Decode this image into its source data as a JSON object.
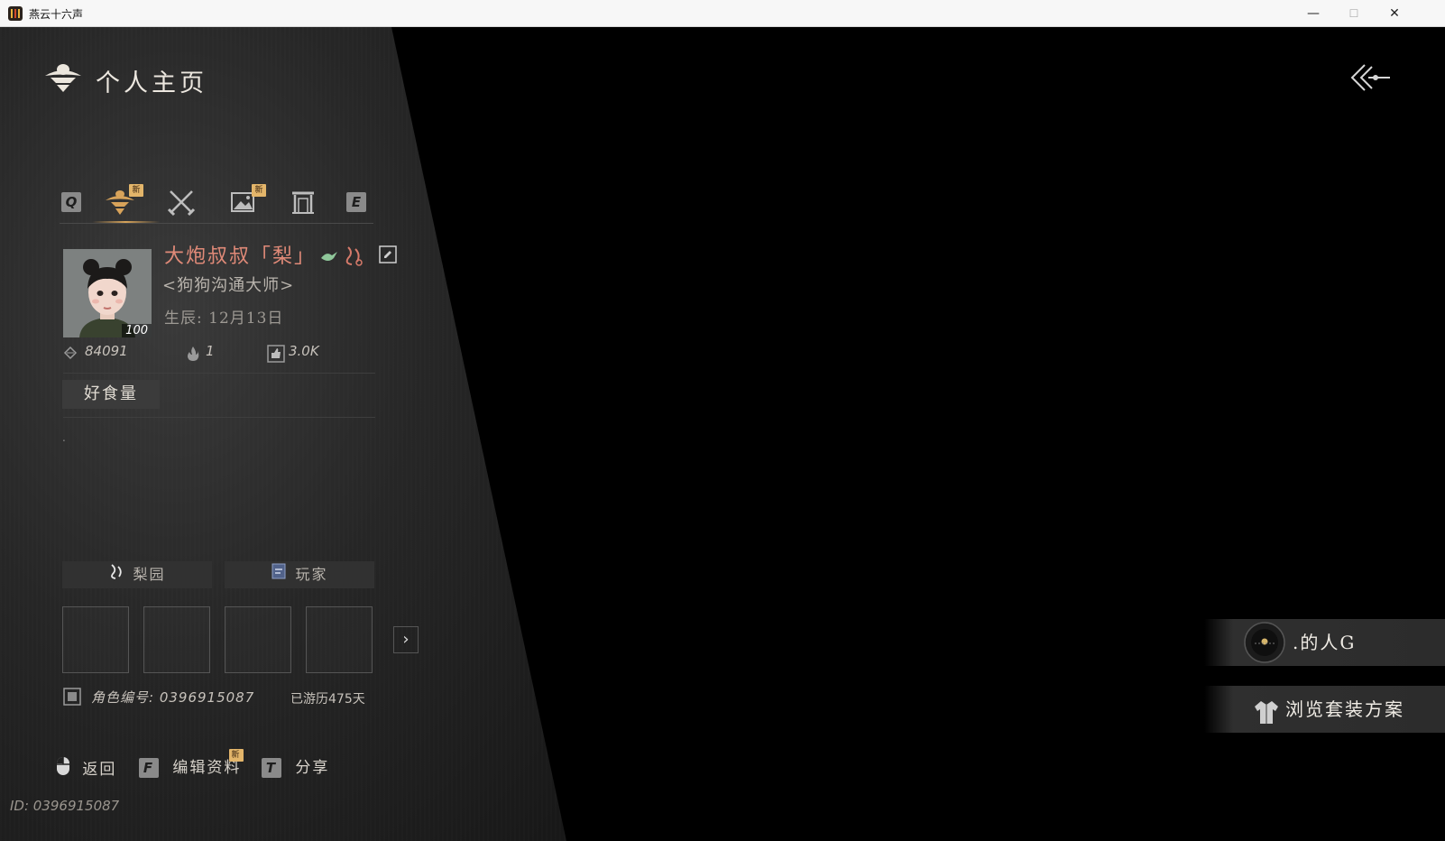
{
  "window": {
    "title": "燕云十六声",
    "minimize": "—",
    "maximize": "☐",
    "close": "✕"
  },
  "header": {
    "title": "个人主页"
  },
  "tabs": {
    "prev_key": "Q",
    "next_key": "E",
    "new_badge": "新",
    "items": [
      {
        "icon": "bee-emblem-icon",
        "active": true,
        "new": true
      },
      {
        "icon": "crossed-swords-icon",
        "active": false,
        "new": false
      },
      {
        "icon": "picture-icon",
        "active": false,
        "new": true
      },
      {
        "icon": "gate-icon",
        "active": false,
        "new": false
      }
    ]
  },
  "profile": {
    "avatar_level": "100",
    "name": "大炮叔叔「梨」",
    "title": "<狗狗沟通大师>",
    "birthday": "生辰: 12月13日",
    "stats": {
      "points": "84091",
      "heat": "1",
      "likes": "3.0K"
    },
    "tag": "好食量",
    "bio": "."
  },
  "collections": {
    "tab1": "梨园",
    "tab2": "玩家",
    "slots": [
      "",
      "",
      "",
      ""
    ]
  },
  "meta": {
    "char_id": "角色编号: 0396915087",
    "days": "已游历475天"
  },
  "hints": {
    "back_label": "返回",
    "edit_key": "F",
    "edit_label": "编辑资料",
    "edit_badge": "新",
    "share_key": "T",
    "share_label": "分享"
  },
  "footer": {
    "id": "ID: 0396915087"
  },
  "right_buttons": {
    "guild": ".的人G",
    "outfit": "浏览套装方案"
  },
  "colors": {
    "name": "#e08a78",
    "accent_gold": "#d6a35a",
    "badge": "#e3b56a"
  }
}
